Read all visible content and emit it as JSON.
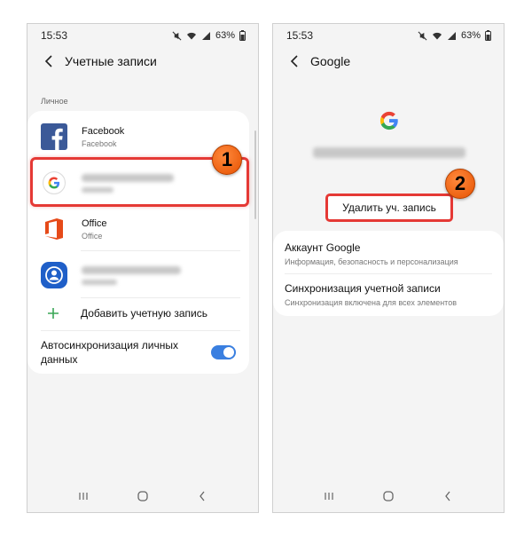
{
  "status": {
    "time": "15:53",
    "battery": "63%"
  },
  "left_screen": {
    "title": "Учетные записи",
    "section": "Личное",
    "accounts": [
      {
        "title": "Facebook",
        "subtitle": "Facebook",
        "icon": "facebook-icon"
      },
      {
        "title": "",
        "subtitle": "",
        "icon": "google-icon",
        "blurred": true
      },
      {
        "title": "Office",
        "subtitle": "Office",
        "icon": "office-icon"
      },
      {
        "title": "",
        "subtitle": "",
        "icon": "person-icon",
        "blurred": true
      }
    ],
    "add_account": "Добавить учетную запись",
    "auto_sync": "Автосинхронизация личных данных",
    "auto_sync_on": true
  },
  "right_screen": {
    "title": "Google",
    "remove_button": "Удалить уч. запись",
    "items": [
      {
        "title": "Аккаунт Google",
        "subtitle": "Информация, безопасность и персонализация"
      },
      {
        "title": "Синхронизация учетной записи",
        "subtitle": "Синхронизация включена для всех элементов"
      }
    ]
  },
  "markers": [
    "1",
    "2"
  ],
  "colors": {
    "highlight": "#e53935",
    "marker": "#f26a1b",
    "toggle": "#3a7fe0",
    "facebook": "#3b5998",
    "office": "#e64a19",
    "person": "#1f5fc8"
  }
}
